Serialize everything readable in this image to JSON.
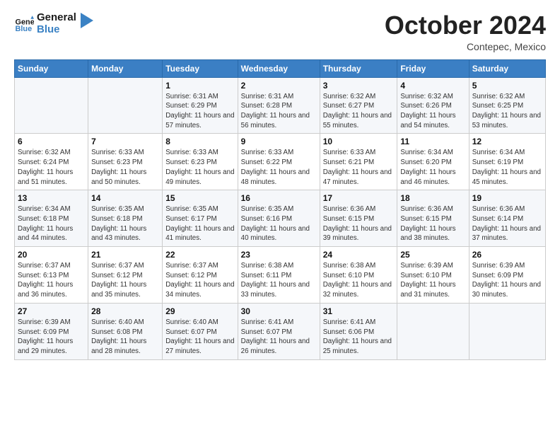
{
  "logo": {
    "text_general": "General",
    "text_blue": "Blue"
  },
  "header": {
    "month": "October 2024",
    "location": "Contepec, Mexico"
  },
  "days_of_week": [
    "Sunday",
    "Monday",
    "Tuesday",
    "Wednesday",
    "Thursday",
    "Friday",
    "Saturday"
  ],
  "weeks": [
    [
      {
        "day": "",
        "sunrise": "",
        "sunset": "",
        "daylight": "",
        "empty": true
      },
      {
        "day": "",
        "sunrise": "",
        "sunset": "",
        "daylight": "",
        "empty": true
      },
      {
        "day": "1",
        "sunrise": "Sunrise: 6:31 AM",
        "sunset": "Sunset: 6:29 PM",
        "daylight": "Daylight: 11 hours and 57 minutes."
      },
      {
        "day": "2",
        "sunrise": "Sunrise: 6:31 AM",
        "sunset": "Sunset: 6:28 PM",
        "daylight": "Daylight: 11 hours and 56 minutes."
      },
      {
        "day": "3",
        "sunrise": "Sunrise: 6:32 AM",
        "sunset": "Sunset: 6:27 PM",
        "daylight": "Daylight: 11 hours and 55 minutes."
      },
      {
        "day": "4",
        "sunrise": "Sunrise: 6:32 AM",
        "sunset": "Sunset: 6:26 PM",
        "daylight": "Daylight: 11 hours and 54 minutes."
      },
      {
        "day": "5",
        "sunrise": "Sunrise: 6:32 AM",
        "sunset": "Sunset: 6:25 PM",
        "daylight": "Daylight: 11 hours and 53 minutes."
      }
    ],
    [
      {
        "day": "6",
        "sunrise": "Sunrise: 6:32 AM",
        "sunset": "Sunset: 6:24 PM",
        "daylight": "Daylight: 11 hours and 51 minutes."
      },
      {
        "day": "7",
        "sunrise": "Sunrise: 6:33 AM",
        "sunset": "Sunset: 6:23 PM",
        "daylight": "Daylight: 11 hours and 50 minutes."
      },
      {
        "day": "8",
        "sunrise": "Sunrise: 6:33 AM",
        "sunset": "Sunset: 6:23 PM",
        "daylight": "Daylight: 11 hours and 49 minutes."
      },
      {
        "day": "9",
        "sunrise": "Sunrise: 6:33 AM",
        "sunset": "Sunset: 6:22 PM",
        "daylight": "Daylight: 11 hours and 48 minutes."
      },
      {
        "day": "10",
        "sunrise": "Sunrise: 6:33 AM",
        "sunset": "Sunset: 6:21 PM",
        "daylight": "Daylight: 11 hours and 47 minutes."
      },
      {
        "day": "11",
        "sunrise": "Sunrise: 6:34 AM",
        "sunset": "Sunset: 6:20 PM",
        "daylight": "Daylight: 11 hours and 46 minutes."
      },
      {
        "day": "12",
        "sunrise": "Sunrise: 6:34 AM",
        "sunset": "Sunset: 6:19 PM",
        "daylight": "Daylight: 11 hours and 45 minutes."
      }
    ],
    [
      {
        "day": "13",
        "sunrise": "Sunrise: 6:34 AM",
        "sunset": "Sunset: 6:18 PM",
        "daylight": "Daylight: 11 hours and 44 minutes."
      },
      {
        "day": "14",
        "sunrise": "Sunrise: 6:35 AM",
        "sunset": "Sunset: 6:18 PM",
        "daylight": "Daylight: 11 hours and 43 minutes."
      },
      {
        "day": "15",
        "sunrise": "Sunrise: 6:35 AM",
        "sunset": "Sunset: 6:17 PM",
        "daylight": "Daylight: 11 hours and 41 minutes."
      },
      {
        "day": "16",
        "sunrise": "Sunrise: 6:35 AM",
        "sunset": "Sunset: 6:16 PM",
        "daylight": "Daylight: 11 hours and 40 minutes."
      },
      {
        "day": "17",
        "sunrise": "Sunrise: 6:36 AM",
        "sunset": "Sunset: 6:15 PM",
        "daylight": "Daylight: 11 hours and 39 minutes."
      },
      {
        "day": "18",
        "sunrise": "Sunrise: 6:36 AM",
        "sunset": "Sunset: 6:15 PM",
        "daylight": "Daylight: 11 hours and 38 minutes."
      },
      {
        "day": "19",
        "sunrise": "Sunrise: 6:36 AM",
        "sunset": "Sunset: 6:14 PM",
        "daylight": "Daylight: 11 hours and 37 minutes."
      }
    ],
    [
      {
        "day": "20",
        "sunrise": "Sunrise: 6:37 AM",
        "sunset": "Sunset: 6:13 PM",
        "daylight": "Daylight: 11 hours and 36 minutes."
      },
      {
        "day": "21",
        "sunrise": "Sunrise: 6:37 AM",
        "sunset": "Sunset: 6:12 PM",
        "daylight": "Daylight: 11 hours and 35 minutes."
      },
      {
        "day": "22",
        "sunrise": "Sunrise: 6:37 AM",
        "sunset": "Sunset: 6:12 PM",
        "daylight": "Daylight: 11 hours and 34 minutes."
      },
      {
        "day": "23",
        "sunrise": "Sunrise: 6:38 AM",
        "sunset": "Sunset: 6:11 PM",
        "daylight": "Daylight: 11 hours and 33 minutes."
      },
      {
        "day": "24",
        "sunrise": "Sunrise: 6:38 AM",
        "sunset": "Sunset: 6:10 PM",
        "daylight": "Daylight: 11 hours and 32 minutes."
      },
      {
        "day": "25",
        "sunrise": "Sunrise: 6:39 AM",
        "sunset": "Sunset: 6:10 PM",
        "daylight": "Daylight: 11 hours and 31 minutes."
      },
      {
        "day": "26",
        "sunrise": "Sunrise: 6:39 AM",
        "sunset": "Sunset: 6:09 PM",
        "daylight": "Daylight: 11 hours and 30 minutes."
      }
    ],
    [
      {
        "day": "27",
        "sunrise": "Sunrise: 6:39 AM",
        "sunset": "Sunset: 6:09 PM",
        "daylight": "Daylight: 11 hours and 29 minutes."
      },
      {
        "day": "28",
        "sunrise": "Sunrise: 6:40 AM",
        "sunset": "Sunset: 6:08 PM",
        "daylight": "Daylight: 11 hours and 28 minutes."
      },
      {
        "day": "29",
        "sunrise": "Sunrise: 6:40 AM",
        "sunset": "Sunset: 6:07 PM",
        "daylight": "Daylight: 11 hours and 27 minutes."
      },
      {
        "day": "30",
        "sunrise": "Sunrise: 6:41 AM",
        "sunset": "Sunset: 6:07 PM",
        "daylight": "Daylight: 11 hours and 26 minutes."
      },
      {
        "day": "31",
        "sunrise": "Sunrise: 6:41 AM",
        "sunset": "Sunset: 6:06 PM",
        "daylight": "Daylight: 11 hours and 25 minutes."
      },
      {
        "day": "",
        "sunrise": "",
        "sunset": "",
        "daylight": "",
        "empty": true
      },
      {
        "day": "",
        "sunrise": "",
        "sunset": "",
        "daylight": "",
        "empty": true
      }
    ]
  ]
}
